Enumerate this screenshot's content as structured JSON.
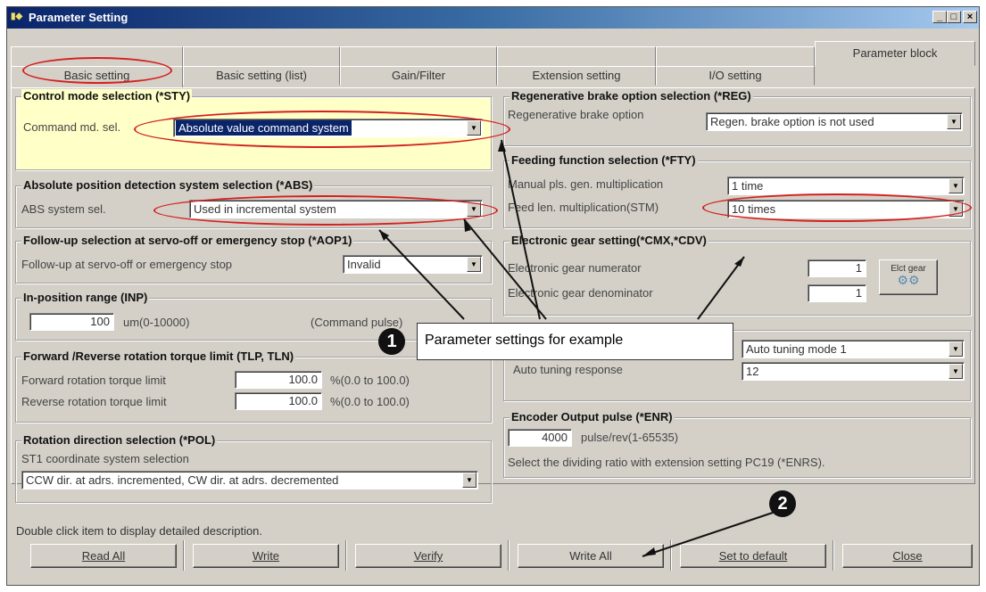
{
  "window": {
    "title": "Parameter Setting"
  },
  "tabs": {
    "basic": "Basic setting",
    "basic_list": "Basic setting (list)",
    "gain": "Gain/Filter",
    "extension": "Extension setting",
    "io": "I/O setting",
    "block": "Parameter block"
  },
  "control_mode": {
    "title": "Control mode selection (*STY)",
    "label": "Command md. sel.",
    "value": "Absolute value command system"
  },
  "abs": {
    "title": "Absolute position detection system selection (*ABS)",
    "label": "ABS system sel.",
    "value": "Used in incremental system"
  },
  "followup": {
    "title": "Follow-up selection at servo-off or emergency stop (*AOP1)",
    "label": "Follow-up at servo-off or emergency stop",
    "value": "Invalid"
  },
  "inposition": {
    "title": "In-position range (INP)",
    "value": "100",
    "unit": "um(0-10000)",
    "note": "(Command pulse)"
  },
  "torque": {
    "title": "Forward /Reverse rotation torque limit (TLP, TLN)",
    "forward_label": "Forward rotation torque limit",
    "forward_value": "100.0",
    "forward_unit": "%(0.0 to 100.0)",
    "reverse_label": "Reverse rotation torque limit",
    "reverse_value": "100.0",
    "reverse_unit": "%(0.0 to 100.0)"
  },
  "rotation": {
    "title": "Rotation direction selection (*POL)",
    "label": "ST1 coordinate system selection",
    "value": "CCW dir. at adrs. incremented, CW dir. at adrs. decremented"
  },
  "regen": {
    "title": "Regenerative brake option selection (*REG)",
    "label": "Regenerative brake option",
    "value": "Regen. brake option is not used"
  },
  "feeding": {
    "title": "Feeding function selection (*FTY)",
    "manual_label": "Manual pls. gen. multiplication",
    "manual_value": "1 time",
    "feed_label": "Feed len. multiplication(STM)",
    "feed_value": "10 times"
  },
  "gear": {
    "title": "Electronic gear setting(*CMX,*CDV)",
    "num_label": "Electronic gear numerator",
    "num_value": "1",
    "den_label": "Electronic gear denominator",
    "den_value": "1",
    "button": "Elct gear"
  },
  "autotune": {
    "mode_value": "Auto tuning mode 1",
    "response_label": "Auto tuning response",
    "response_value": "12"
  },
  "encoder": {
    "title": "Encoder Output pulse (*ENR)",
    "value": "4000",
    "unit": "pulse/rev(1-65535)",
    "note": "Select the dividing ratio with extension setting PC19 (*ENRS)."
  },
  "footer": {
    "hint": "Double click item to display detailed description.",
    "read_all": "Read All",
    "write": "Write",
    "verify": "Verify",
    "write_all": "Write All",
    "set_default": "Set to default",
    "close": "Close"
  },
  "annotation": {
    "marker1": "1",
    "marker2": "2",
    "callout": "Parameter settings for example"
  },
  "colors": {
    "ellipse": "#d42020",
    "title_bar": "#0a246a",
    "highlight_group": "#ffffc8"
  }
}
